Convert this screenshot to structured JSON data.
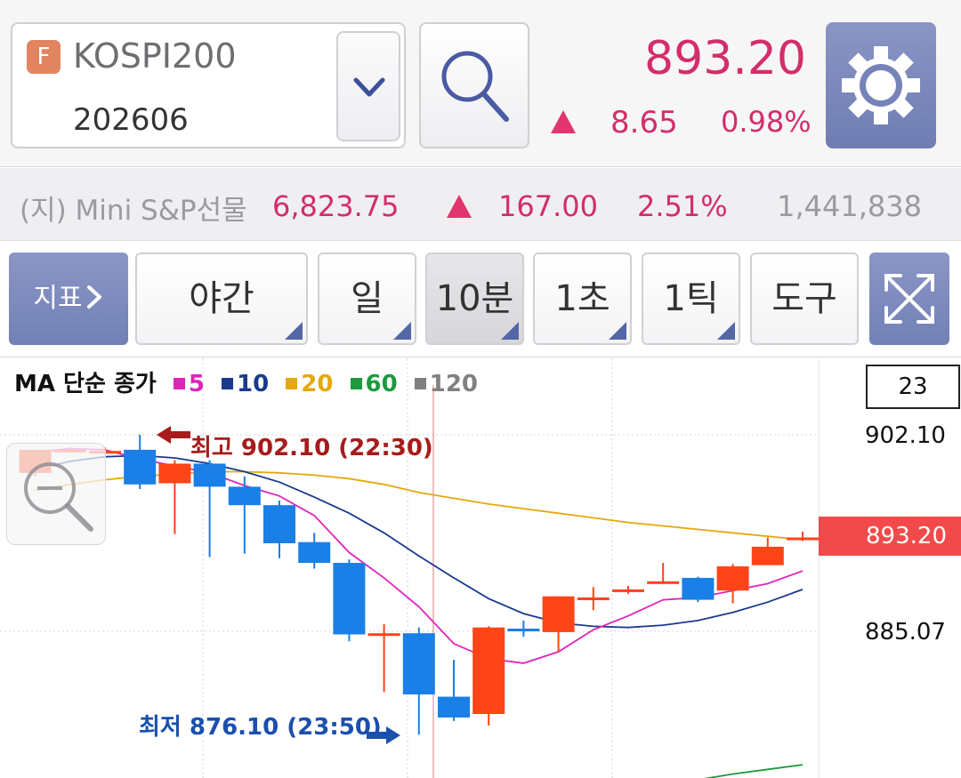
{
  "header": {
    "badge": "F",
    "symbol_name": "KOSPI200",
    "symbol_code": "202606",
    "price": "893.20",
    "change": "8.65",
    "change_pct": "0.98%",
    "up_color": "#e2356f"
  },
  "ticker": {
    "name": "(지) Mini S&P선물",
    "price": "6,823.75",
    "change": "167.00",
    "change_pct": "2.51%",
    "volume": "1,441,838"
  },
  "toolbar": {
    "indicator": "지표",
    "session": "야간",
    "day": "일",
    "minute": "10분",
    "second": "1초",
    "tick": "1틱",
    "tools": "도구",
    "selected": "10분"
  },
  "chart_legend": {
    "prefix": "MA 단순 종가",
    "items": [
      {
        "label": "5",
        "color": "#e024b8"
      },
      {
        "label": "10",
        "color": "#1a3a8c"
      },
      {
        "label": "20",
        "color": "#e5a80e"
      },
      {
        "label": "60",
        "color": "#1e9a3f"
      },
      {
        "label": "120",
        "color": "#808080"
      }
    ]
  },
  "chart_info": {
    "count": "23",
    "axis_top": "902.10",
    "axis_mid": "885.07",
    "current": "893.20",
    "high_label": "최고 902.10 (22:30)",
    "low_label": "최저 876.10 (23:50)"
  },
  "chart_data": {
    "type": "candlestick",
    "candles": [
      {
        "o": 898.8,
        "h": 899.6,
        "c": 900.8,
        "l": 898.5,
        "dir": "up"
      },
      {
        "o": 900.8,
        "h": 901.0,
        "c": 900.8,
        "l": 900.6,
        "dir": "up"
      },
      {
        "o": 900.7,
        "h": 901.0,
        "c": 900.7,
        "l": 900.4,
        "dir": "up"
      },
      {
        "o": 900.8,
        "h": 902.1,
        "c": 897.8,
        "l": 897.4,
        "dir": "down"
      },
      {
        "o": 897.9,
        "h": 899.9,
        "c": 899.6,
        "l": 893.5,
        "dir": "up"
      },
      {
        "o": 899.6,
        "h": 899.9,
        "c": 897.6,
        "l": 891.5,
        "dir": "down"
      },
      {
        "o": 897.6,
        "h": 898.5,
        "c": 896.0,
        "l": 891.8,
        "dir": "down"
      },
      {
        "o": 896.0,
        "h": 896.4,
        "c": 892.7,
        "l": 891.4,
        "dir": "down"
      },
      {
        "o": 892.8,
        "h": 893.6,
        "c": 891.0,
        "l": 890.5,
        "dir": "down"
      },
      {
        "o": 891.0,
        "h": 891.3,
        "c": 884.8,
        "l": 884.2,
        "dir": "down"
      },
      {
        "o": 884.9,
        "h": 885.7,
        "c": 884.9,
        "l": 879.8,
        "dir": "up"
      },
      {
        "o": 884.9,
        "h": 885.4,
        "c": 879.6,
        "l": 876.1,
        "dir": "down"
      },
      {
        "o": 879.4,
        "h": 882.6,
        "c": 877.6,
        "l": 877.3,
        "dir": "down"
      },
      {
        "o": 877.9,
        "h": 885.5,
        "c": 885.4,
        "l": 876.9,
        "dir": "up"
      },
      {
        "o": 885.3,
        "h": 886.0,
        "c": 885.2,
        "l": 884.6,
        "dir": "down"
      },
      {
        "o": 885.0,
        "h": 888.1,
        "c": 888.1,
        "l": 883.3,
        "dir": "up"
      },
      {
        "o": 888.0,
        "h": 888.9,
        "c": 888.0,
        "l": 886.9,
        "dir": "up"
      },
      {
        "o": 888.6,
        "h": 889.0,
        "c": 888.7,
        "l": 888.3,
        "dir": "up"
      },
      {
        "o": 889.4,
        "h": 891.0,
        "c": 889.4,
        "l": 889.2,
        "dir": "up"
      },
      {
        "o": 889.7,
        "h": 889.8,
        "c": 887.8,
        "l": 887.6,
        "dir": "down"
      },
      {
        "o": 888.6,
        "h": 890.9,
        "c": 890.7,
        "l": 887.5,
        "dir": "up"
      },
      {
        "o": 890.8,
        "h": 893.2,
        "c": 892.4,
        "l": 890.8,
        "dir": "up"
      },
      {
        "o": 893.0,
        "h": 893.7,
        "c": 893.2,
        "l": 892.9,
        "dir": "up"
      }
    ],
    "ma5": [
      900.6,
      900.9,
      900.8,
      900.0,
      899.4,
      898.8,
      897.7,
      896.8,
      895.1,
      891.9,
      889.7,
      887.2,
      884.0,
      882.7,
      882.3,
      883.3,
      885.2,
      886.4,
      887.8,
      888.0,
      888.6,
      889.2,
      890.3
    ],
    "ma10": [
      899.1,
      899.8,
      900.2,
      900.3,
      900.1,
      899.6,
      898.9,
      898.0,
      896.7,
      895.3,
      893.6,
      891.6,
      889.7,
      887.9,
      886.6,
      885.8,
      885.5,
      885.4,
      885.6,
      886.0,
      886.7,
      887.6,
      888.7
    ],
    "ma20": [
      897.3,
      897.8,
      898.2,
      898.5,
      898.7,
      898.9,
      898.9,
      898.8,
      898.6,
      898.3,
      897.8,
      897.1,
      896.6,
      896.1,
      895.7,
      895.3,
      894.9,
      894.5,
      894.2,
      893.9,
      893.6,
      893.3,
      893.0
    ],
    "ma60": [
      null,
      null,
      null,
      null,
      null,
      null,
      null,
      null,
      null,
      null,
      null,
      null,
      null,
      null,
      null,
      null,
      null,
      null,
      null,
      872.2,
      872.7,
      873.1,
      873.5
    ],
    "ylim": [
      872.0,
      904.5
    ],
    "axis_ticks": [
      902.1,
      885.07
    ],
    "current_price": 893.2,
    "high": 902.1,
    "low": 876.1,
    "up_color": "#ff4418",
    "down_color": "#1a7fe6"
  }
}
